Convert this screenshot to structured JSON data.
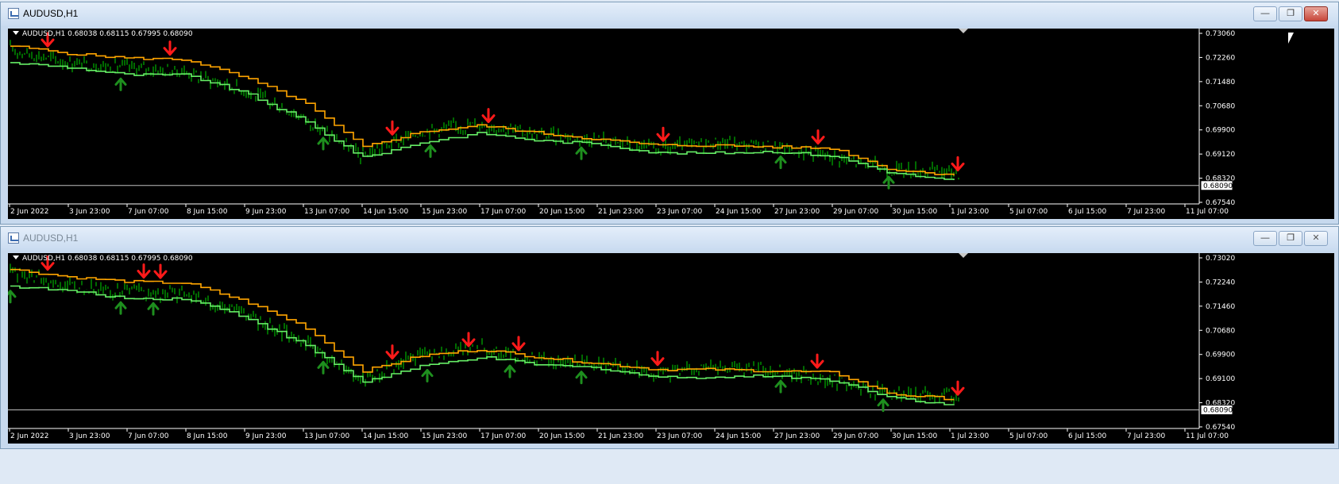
{
  "windows": [
    {
      "title": "AUDUSD,H1",
      "active": true,
      "info": "AUDUSD,H1  0.68038 0.68115 0.67995 0.68090",
      "price_ticks": [
        "0.73060",
        "0.72260",
        "0.71480",
        "0.70680",
        "0.69900",
        "0.69120",
        "0.68320",
        "0.67540"
      ],
      "ylim": [
        0.6754,
        0.7306
      ],
      "current_price": "0.68090",
      "current_price_value": 0.6809,
      "down_arrows": [
        50,
        204,
        484,
        605,
        825,
        1020,
        1196
      ],
      "up_arrows": [
        142,
        397,
        532,
        722,
        973,
        1109
      ]
    },
    {
      "title": "AUDUSD,H1",
      "active": false,
      "info": "AUDUSD,H1  0.68038 0.68115 0.67995 0.68090",
      "price_ticks": [
        "0.73020",
        "0.72240",
        "0.71460",
        "0.70680",
        "0.69900",
        "0.69100",
        "0.68320",
        "0.67540"
      ],
      "ylim": [
        0.6754,
        0.7302
      ],
      "current_price": "0.68090",
      "current_price_value": 0.6809,
      "down_arrows": [
        50,
        171,
        192,
        484,
        580,
        643,
        818,
        1019,
        1196
      ],
      "up_arrows": [
        3,
        142,
        183,
        397,
        528,
        632,
        722,
        973,
        1102
      ]
    }
  ],
  "time_ticks": [
    "2 Jun 2022",
    "3 Jun 23:00",
    "7 Jun 07:00",
    "8 Jun 15:00",
    "9 Jun 23:00",
    "13 Jun 07:00",
    "14 Jun 15:00",
    "15 Jun 23:00",
    "17 Jun 07:00",
    "20 Jun 15:00",
    "21 Jun 23:00",
    "23 Jun 07:00",
    "24 Jun 15:00",
    "27 Jun 23:00",
    "29 Jun 07:00",
    "30 Jun 15:00",
    "1 Jul 23:00",
    "5 Jul 07:00",
    "6 Jul 15:00",
    "7 Jul 23:00",
    "11 Jul 07:00"
  ],
  "chart_data": {
    "type": "line",
    "symbol": "AUDUSD",
    "timeframe": "H1",
    "categories": [
      "2 Jun 2022",
      "3 Jun 23:00",
      "7 Jun 07:00",
      "8 Jun 15:00",
      "9 Jun 23:00",
      "13 Jun 07:00",
      "14 Jun 15:00",
      "15 Jun 23:00",
      "17 Jun 07:00",
      "20 Jun 15:00",
      "21 Jun 23:00",
      "23 Jun 07:00",
      "24 Jun 15:00",
      "27 Jun 23:00",
      "29 Jun 07:00",
      "30 Jun 15:00",
      "1 Jul 23:00",
      "5 Jul 07:00",
      "6 Jul 15:00",
      "7 Jul 23:00",
      "11 Jul 07:00"
    ],
    "series": [
      {
        "values": [
          0.7255,
          0.721,
          0.7195,
          0.718,
          0.712,
          0.703,
          0.6905,
          0.6985,
          0.701,
          0.6975,
          0.696,
          0.6925,
          0.695,
          0.6935,
          0.6905,
          0.686,
          0.6855,
          0.683,
          0.682,
          0.6835,
          0.6809
        ]
      },
      {
        "values": [
          0.7265,
          0.724,
          0.7225,
          0.722,
          0.716,
          0.708,
          0.6935,
          0.6985,
          0.7005,
          0.698,
          0.696,
          0.694,
          0.694,
          0.6935,
          0.693,
          0.686,
          0.6845,
          0.6835,
          0.6835,
          0.684,
          0.6835
        ]
      },
      {
        "values": [
          0.721,
          0.7195,
          0.717,
          0.717,
          0.711,
          0.702,
          0.69,
          0.695,
          0.698,
          0.6955,
          0.6945,
          0.6915,
          0.6915,
          0.692,
          0.6905,
          0.685,
          0.6825,
          0.6815,
          0.6795,
          0.6815,
          0.682
        ]
      }
    ],
    "colors": {
      "price": "#00b000",
      "resistance": "#ffa500",
      "support": "#66ee66",
      "arrow_down": "#ff1a1a",
      "arrow_up": "#1e8f1e",
      "background": "#000000",
      "axis": "#ffffff"
    },
    "ylim": [
      0.6754,
      0.7306
    ]
  }
}
